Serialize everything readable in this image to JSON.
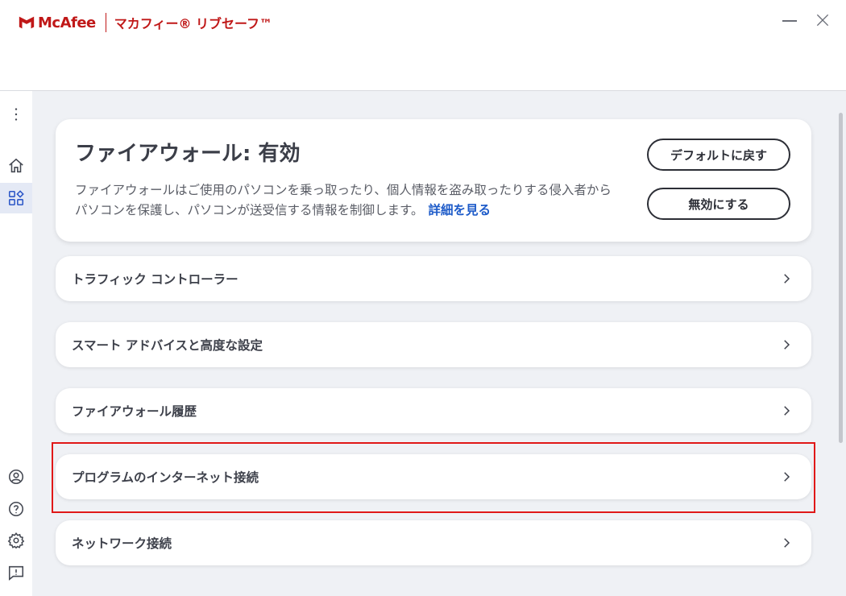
{
  "window": {
    "brand": "McAfee",
    "product": "マカフィー® リブセーフ™",
    "minimize_label": "—",
    "close_label": "✕"
  },
  "sidebar": {
    "items": [
      {
        "icon": "more-vert-icon"
      },
      {
        "icon": "home-icon"
      },
      {
        "icon": "apps-icon",
        "active": true
      },
      {
        "icon": "account-icon"
      },
      {
        "icon": "help-icon"
      },
      {
        "icon": "settings-icon"
      },
      {
        "icon": "feedback-icon"
      }
    ]
  },
  "firewall": {
    "title": "ファイアウォール: 有効",
    "description": "ファイアウォールはご使用のパソコンを乗っ取ったり、個人情報を盗み取ったりする侵入者からパソコンを保護し、パソコンが送受信する情報を制御します。",
    "learn_more": "詳細を見る",
    "restore_default_button": "デフォルトに戻す",
    "disable_button": "無効にする"
  },
  "rows": [
    {
      "label": "トラフィック コントローラー"
    },
    {
      "label": "スマート アドバイスと高度な設定"
    },
    {
      "label": "ファイアウォール履歴"
    },
    {
      "label": "プログラムのインターネット接続"
    },
    {
      "label": "ネットワーク接続"
    }
  ],
  "colors": {
    "brand_red": "#c01818",
    "link_blue": "#1f5cc9",
    "highlight_red": "#e01818",
    "background": "#eff1f5"
  }
}
